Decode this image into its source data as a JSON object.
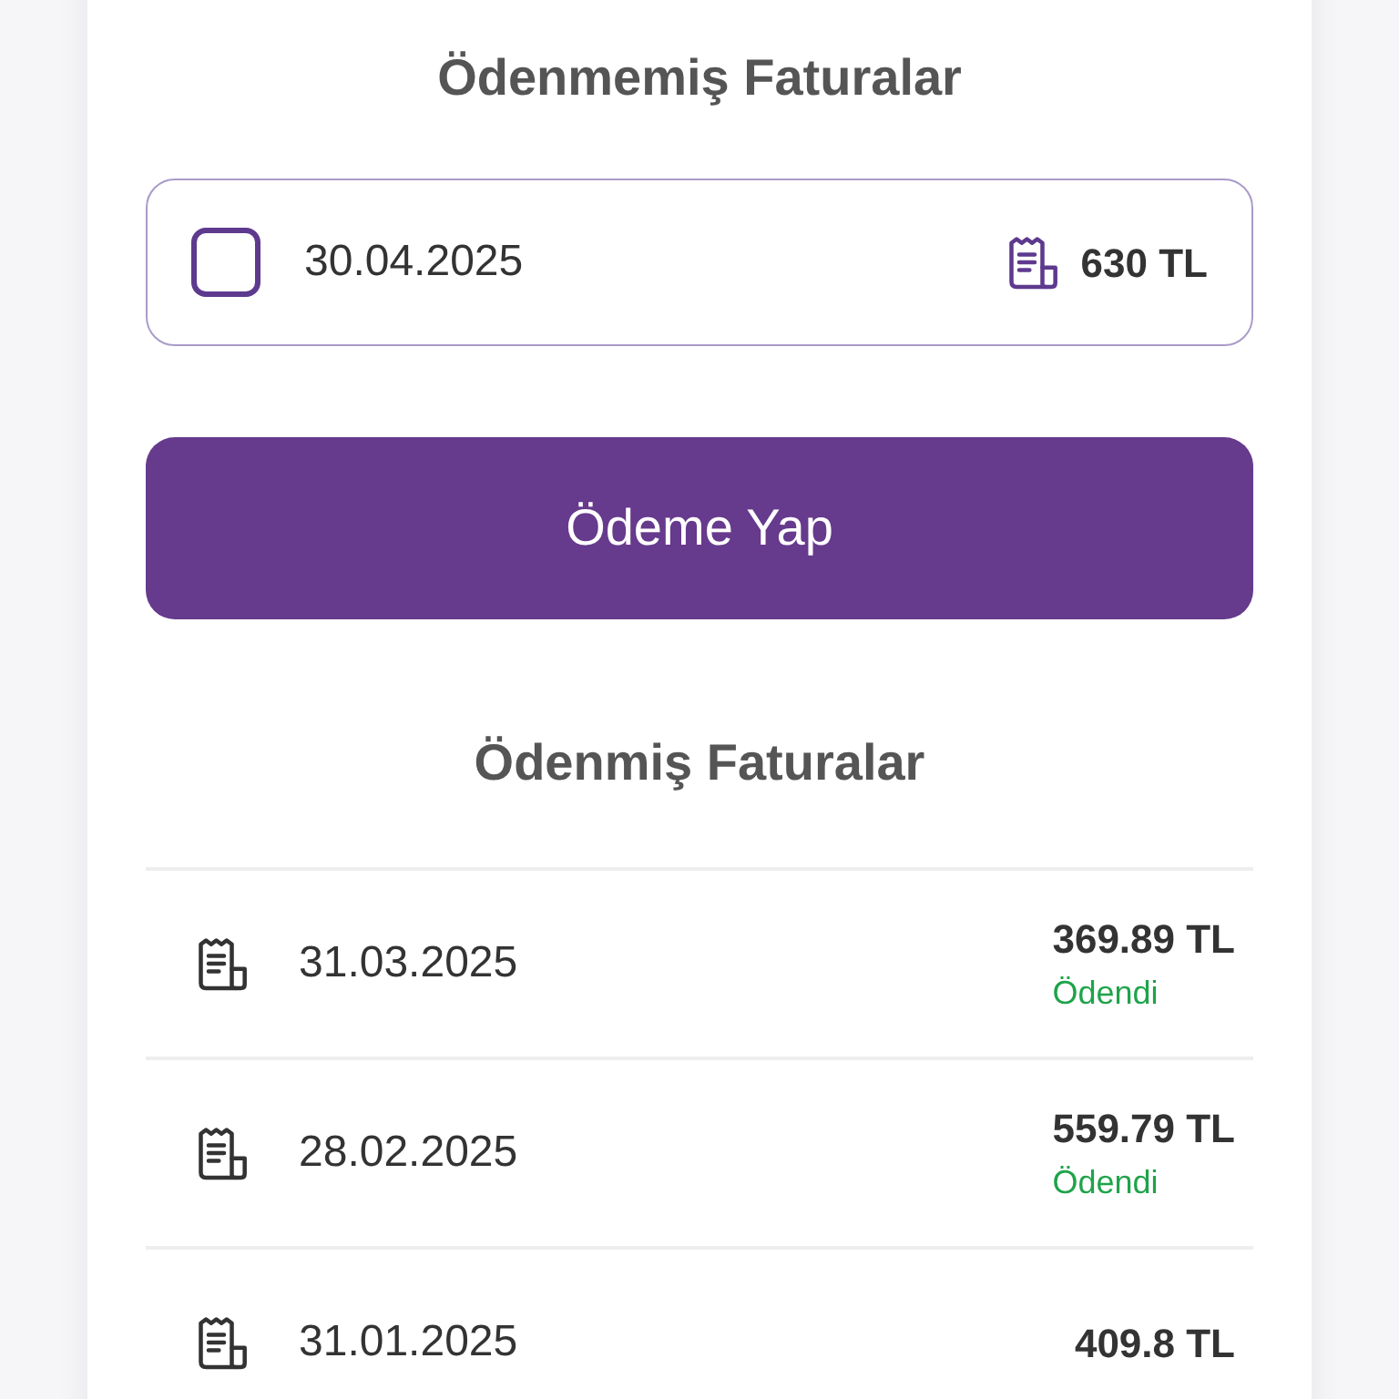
{
  "unpaid": {
    "title": "Ödenmemiş Faturalar",
    "items": [
      {
        "date": "30.04.2025",
        "amount": "630 TL",
        "checked": false
      }
    ]
  },
  "pay_button": "Ödeme Yap",
  "paid": {
    "title": "Ödenmiş Faturalar",
    "items": [
      {
        "date": "31.03.2025",
        "amount": "369.89 TL",
        "status": "Ödendi"
      },
      {
        "date": "28.02.2025",
        "amount": "559.79 TL",
        "status": "Ödendi"
      },
      {
        "date": "31.01.2025",
        "amount": "409.8 TL"
      }
    ]
  }
}
